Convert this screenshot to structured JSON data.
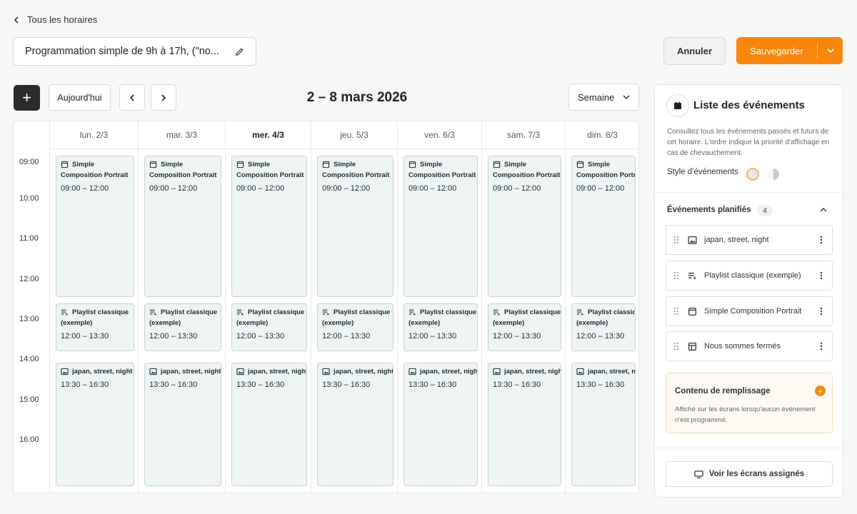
{
  "back_label": "Tous les horaires",
  "schedule_name": "Programmation simple de 9h à 17h, (\"no...",
  "actions": {
    "cancel": "Annuler",
    "save": "Sauvegarder"
  },
  "toolbar": {
    "add": "+",
    "today": "Aujourd'hui",
    "range": "2 – 8 mars 2026",
    "view": "Semaine"
  },
  "days": [
    {
      "label": "lun. 2/3",
      "today": false
    },
    {
      "label": "mar. 3/3",
      "today": false
    },
    {
      "label": "mer. 4/3",
      "today": true
    },
    {
      "label": "jeu. 5/3",
      "today": false
    },
    {
      "label": "ven. 6/3",
      "today": false
    },
    {
      "label": "sam. 7/3",
      "today": false
    },
    {
      "label": "dim. 8/3",
      "today": false
    }
  ],
  "times": [
    "09:00",
    "10:00",
    "11:00",
    "12:00",
    "13:00",
    "14:00",
    "15:00",
    "16:00"
  ],
  "events": [
    {
      "icon": "composition-icon",
      "line1": "Simple",
      "line2": "Composition Portrait",
      "time": "09:00 – 12:00"
    },
    {
      "icon": "playlist-icon",
      "line1": "Playlist classique",
      "line2": "(exemple)",
      "time": "12:00 – 13:30"
    },
    {
      "icon": "image-icon",
      "line1": "japan, street, night",
      "line2": "",
      "time": "13:30 – 16:30"
    }
  ],
  "panel": {
    "title": "Liste des événements",
    "description": "Consultez tous les événements passés et futurs de cet horaire. L'ordre indique la priorité d'affichage en cas de chevauchement.",
    "style_label": "Style d'événements",
    "scheduled_title": "Événements planifiés",
    "scheduled_count": "4",
    "items": [
      {
        "icon": "image-icon",
        "label": "japan, street, night"
      },
      {
        "icon": "playlist-icon",
        "label": "Playlist classique (exemple)"
      },
      {
        "icon": "composition-icon",
        "label": "Simple Composition Portrait"
      },
      {
        "icon": "layout-icon",
        "label": "Nous sommes fermés"
      }
    ],
    "fill_title": "Contenu de remplissage",
    "fill_add": "+",
    "fill_desc": "Affiché sur les écrans lorsqu'aucun événement n'est programmé.",
    "screens_button": "Voir les écrans assignés"
  },
  "colors": {
    "accent": "#f7870e",
    "event_bg": "#eef3f3",
    "event_border": "#c8d3d3"
  }
}
